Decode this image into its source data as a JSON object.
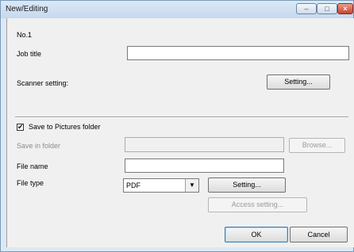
{
  "window": {
    "title": "New/Editing",
    "minimize_glyph": "–",
    "maximize_glyph": "□",
    "close_glyph": "×"
  },
  "form": {
    "number_label": "No.1",
    "job_title_label": "Job title",
    "job_title_value": "",
    "scanner_setting_label": "Scanner setting:",
    "scanner_setting_button": "Setting...",
    "save_to_pictures_label": "Save to Pictures folder",
    "save_to_pictures_checked": true,
    "check_glyph": "✔",
    "save_in_folder_label": "Save in folder",
    "save_in_folder_value": "",
    "browse_button": "Browse...",
    "file_name_label": "File name",
    "file_name_value": "",
    "file_type_label": "File type",
    "file_type_value": "PDF",
    "dropdown_glyph": "▼",
    "file_type_setting_button": "Setting...",
    "access_setting_button": "Access setting..."
  },
  "footer": {
    "ok_button": "OK",
    "cancel_button": "Cancel"
  }
}
